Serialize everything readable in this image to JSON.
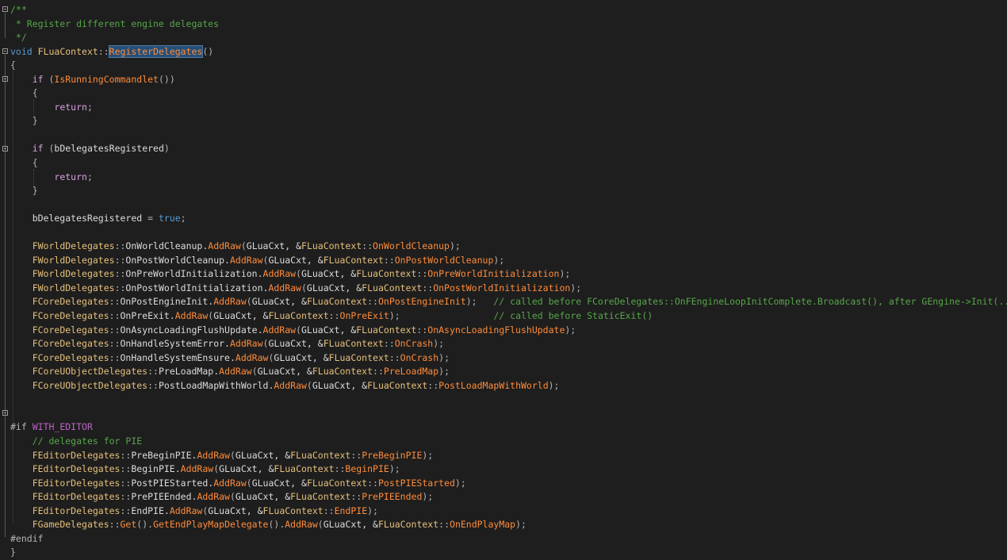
{
  "editor": {
    "lines": [
      [
        [
          "c-comment",
          "/**"
        ]
      ],
      [
        [
          "c-comment",
          " * Register different engine delegates"
        ]
      ],
      [
        [
          "c-comment",
          " */"
        ]
      ],
      [
        [
          "c-kw",
          "void"
        ],
        [
          "c-plain",
          " "
        ],
        [
          "c-type",
          "FLuaContext"
        ],
        [
          "c-punc",
          "::"
        ],
        [
          "sel c-method",
          "RegisterDelegates"
        ],
        [
          "c-punc",
          "()"
        ]
      ],
      [
        [
          "c-punc",
          "{"
        ]
      ],
      [
        [
          "c-plain",
          "    "
        ],
        [
          "c-kw2",
          "if"
        ],
        [
          "c-punc",
          " ("
        ],
        [
          "c-method",
          "IsRunningCommandlet"
        ],
        [
          "c-punc",
          "())"
        ]
      ],
      [
        [
          "c-plain",
          "    "
        ],
        [
          "c-punc",
          "{"
        ]
      ],
      [
        [
          "c-plain",
          "        "
        ],
        [
          "c-kw2",
          "return"
        ],
        [
          "c-punc",
          ";"
        ]
      ],
      [
        [
          "c-plain",
          "    "
        ],
        [
          "c-punc",
          "}"
        ]
      ],
      [
        [
          "c-plain",
          ""
        ]
      ],
      [
        [
          "c-plain",
          "    "
        ],
        [
          "c-kw2",
          "if"
        ],
        [
          "c-punc",
          " ("
        ],
        [
          "c-plain",
          "bDelegatesRegistered"
        ],
        [
          "c-punc",
          ")"
        ]
      ],
      [
        [
          "c-plain",
          "    "
        ],
        [
          "c-punc",
          "{"
        ]
      ],
      [
        [
          "c-plain",
          "        "
        ],
        [
          "c-kw2",
          "return"
        ],
        [
          "c-punc",
          ";"
        ]
      ],
      [
        [
          "c-plain",
          "    "
        ],
        [
          "c-punc",
          "}"
        ]
      ],
      [
        [
          "c-plain",
          ""
        ]
      ],
      [
        [
          "c-plain",
          "    bDelegatesRegistered "
        ],
        [
          "c-punc",
          "= "
        ],
        [
          "c-kw",
          "true"
        ],
        [
          "c-punc",
          ";"
        ]
      ],
      [
        [
          "c-plain",
          ""
        ]
      ],
      [
        [
          "c-plain",
          "    "
        ],
        [
          "c-type",
          "FWorldDelegates"
        ],
        [
          "c-punc",
          "::"
        ],
        [
          "c-plain",
          "OnWorldCleanup."
        ],
        [
          "c-method",
          "AddRaw"
        ],
        [
          "c-punc",
          "("
        ],
        [
          "c-plain",
          "GLuaCxt, &"
        ],
        [
          "c-type",
          "FLuaContext"
        ],
        [
          "c-punc",
          "::"
        ],
        [
          "c-method",
          "OnWorldCleanup"
        ],
        [
          "c-punc",
          ");"
        ]
      ],
      [
        [
          "c-plain",
          "    "
        ],
        [
          "c-type",
          "FWorldDelegates"
        ],
        [
          "c-punc",
          "::"
        ],
        [
          "c-plain",
          "OnPostWorldCleanup."
        ],
        [
          "c-method",
          "AddRaw"
        ],
        [
          "c-punc",
          "("
        ],
        [
          "c-plain",
          "GLuaCxt, &"
        ],
        [
          "c-type",
          "FLuaContext"
        ],
        [
          "c-punc",
          "::"
        ],
        [
          "c-method",
          "OnPostWorldCleanup"
        ],
        [
          "c-punc",
          ");"
        ]
      ],
      [
        [
          "c-plain",
          "    "
        ],
        [
          "c-type",
          "FWorldDelegates"
        ],
        [
          "c-punc",
          "::"
        ],
        [
          "c-plain",
          "OnPreWorldInitialization."
        ],
        [
          "c-method",
          "AddRaw"
        ],
        [
          "c-punc",
          "("
        ],
        [
          "c-plain",
          "GLuaCxt, &"
        ],
        [
          "c-type",
          "FLuaContext"
        ],
        [
          "c-punc",
          "::"
        ],
        [
          "c-method",
          "OnPreWorldInitialization"
        ],
        [
          "c-punc",
          ");"
        ]
      ],
      [
        [
          "c-plain",
          "    "
        ],
        [
          "c-type",
          "FWorldDelegates"
        ],
        [
          "c-punc",
          "::"
        ],
        [
          "c-plain",
          "OnPostWorldInitialization."
        ],
        [
          "c-method",
          "AddRaw"
        ],
        [
          "c-punc",
          "("
        ],
        [
          "c-plain",
          "GLuaCxt, &"
        ],
        [
          "c-type",
          "FLuaContext"
        ],
        [
          "c-punc",
          "::"
        ],
        [
          "c-method",
          "OnPostWorldInitialization"
        ],
        [
          "c-punc",
          ");"
        ]
      ],
      [
        [
          "c-plain",
          "    "
        ],
        [
          "c-type",
          "FCoreDelegates"
        ],
        [
          "c-punc",
          "::"
        ],
        [
          "c-plain",
          "OnPostEngineInit."
        ],
        [
          "c-method",
          "AddRaw"
        ],
        [
          "c-punc",
          "("
        ],
        [
          "c-plain",
          "GLuaCxt, &"
        ],
        [
          "c-type",
          "FLuaContext"
        ],
        [
          "c-punc",
          "::"
        ],
        [
          "c-method",
          "OnPostEngineInit"
        ],
        [
          "c-punc",
          ");   "
        ],
        [
          "c-comment",
          "// called before FCoreDelegates::OnFEngineLoopInitComplete.Broadcast(), after GEngine->Init(...)"
        ]
      ],
      [
        [
          "c-plain",
          "    "
        ],
        [
          "c-type",
          "FCoreDelegates"
        ],
        [
          "c-punc",
          "::"
        ],
        [
          "c-plain",
          "OnPreExit."
        ],
        [
          "c-method",
          "AddRaw"
        ],
        [
          "c-punc",
          "("
        ],
        [
          "c-plain",
          "GLuaCxt, &"
        ],
        [
          "c-type",
          "FLuaContext"
        ],
        [
          "c-punc",
          "::"
        ],
        [
          "c-method",
          "OnPreExit"
        ],
        [
          "c-punc",
          ");                 "
        ],
        [
          "c-comment",
          "// called before StaticExit()"
        ]
      ],
      [
        [
          "c-plain",
          "    "
        ],
        [
          "c-type",
          "FCoreDelegates"
        ],
        [
          "c-punc",
          "::"
        ],
        [
          "c-plain",
          "OnAsyncLoadingFlushUpdate."
        ],
        [
          "c-method",
          "AddRaw"
        ],
        [
          "c-punc",
          "("
        ],
        [
          "c-plain",
          "GLuaCxt, &"
        ],
        [
          "c-type",
          "FLuaContext"
        ],
        [
          "c-punc",
          "::"
        ],
        [
          "c-method",
          "OnAsyncLoadingFlushUpdate"
        ],
        [
          "c-punc",
          ");"
        ]
      ],
      [
        [
          "c-plain",
          "    "
        ],
        [
          "c-type",
          "FCoreDelegates"
        ],
        [
          "c-punc",
          "::"
        ],
        [
          "c-plain",
          "OnHandleSystemError."
        ],
        [
          "c-method",
          "AddRaw"
        ],
        [
          "c-punc",
          "("
        ],
        [
          "c-plain",
          "GLuaCxt, &"
        ],
        [
          "c-type",
          "FLuaContext"
        ],
        [
          "c-punc",
          "::"
        ],
        [
          "c-method",
          "OnCrash"
        ],
        [
          "c-punc",
          ");"
        ]
      ],
      [
        [
          "c-plain",
          "    "
        ],
        [
          "c-type",
          "FCoreDelegates"
        ],
        [
          "c-punc",
          "::"
        ],
        [
          "c-plain",
          "OnHandleSystemEnsure."
        ],
        [
          "c-method",
          "AddRaw"
        ],
        [
          "c-punc",
          "("
        ],
        [
          "c-plain",
          "GLuaCxt, &"
        ],
        [
          "c-type",
          "FLuaContext"
        ],
        [
          "c-punc",
          "::"
        ],
        [
          "c-method",
          "OnCrash"
        ],
        [
          "c-punc",
          ");"
        ]
      ],
      [
        [
          "c-plain",
          "    "
        ],
        [
          "c-type",
          "FCoreUObjectDelegates"
        ],
        [
          "c-punc",
          "::"
        ],
        [
          "c-plain",
          "PreLoadMap."
        ],
        [
          "c-method",
          "AddRaw"
        ],
        [
          "c-punc",
          "("
        ],
        [
          "c-plain",
          "GLuaCxt, &"
        ],
        [
          "c-type",
          "FLuaContext"
        ],
        [
          "c-punc",
          "::"
        ],
        [
          "c-method",
          "PreLoadMap"
        ],
        [
          "c-punc",
          ");"
        ]
      ],
      [
        [
          "c-plain",
          "    "
        ],
        [
          "c-type",
          "FCoreUObjectDelegates"
        ],
        [
          "c-punc",
          "::"
        ],
        [
          "c-plain",
          "PostLoadMapWithWorld."
        ],
        [
          "c-method",
          "AddRaw"
        ],
        [
          "c-punc",
          "("
        ],
        [
          "c-plain",
          "GLuaCxt, &"
        ],
        [
          "c-type",
          "FLuaContext"
        ],
        [
          "c-punc",
          "::"
        ],
        [
          "c-method",
          "PostLoadMapWithWorld"
        ],
        [
          "c-punc",
          ");"
        ]
      ],
      [
        [
          "c-plain",
          ""
        ]
      ],
      [
        [
          "c-plain",
          ""
        ]
      ],
      [
        [
          "c-punc",
          "#if "
        ],
        [
          "c-macro",
          "WITH_EDITOR"
        ]
      ],
      [
        [
          "c-plain",
          "    "
        ],
        [
          "c-comment",
          "// delegates for PIE"
        ]
      ],
      [
        [
          "c-plain",
          "    "
        ],
        [
          "c-type",
          "FEditorDelegates"
        ],
        [
          "c-punc",
          "::"
        ],
        [
          "c-plain",
          "PreBeginPIE."
        ],
        [
          "c-method",
          "AddRaw"
        ],
        [
          "c-punc",
          "("
        ],
        [
          "c-plain",
          "GLuaCxt, &"
        ],
        [
          "c-type",
          "FLuaContext"
        ],
        [
          "c-punc",
          "::"
        ],
        [
          "c-method",
          "PreBeginPIE"
        ],
        [
          "c-punc",
          ");"
        ]
      ],
      [
        [
          "c-plain",
          "    "
        ],
        [
          "c-type",
          "FEditorDelegates"
        ],
        [
          "c-punc",
          "::"
        ],
        [
          "c-plain",
          "BeginPIE."
        ],
        [
          "c-method",
          "AddRaw"
        ],
        [
          "c-punc",
          "("
        ],
        [
          "c-plain",
          "GLuaCxt, &"
        ],
        [
          "c-type",
          "FLuaContext"
        ],
        [
          "c-punc",
          "::"
        ],
        [
          "c-method",
          "BeginPIE"
        ],
        [
          "c-punc",
          ");"
        ]
      ],
      [
        [
          "c-plain",
          "    "
        ],
        [
          "c-type",
          "FEditorDelegates"
        ],
        [
          "c-punc",
          "::"
        ],
        [
          "c-plain",
          "PostPIEStarted."
        ],
        [
          "c-method",
          "AddRaw"
        ],
        [
          "c-punc",
          "("
        ],
        [
          "c-plain",
          "GLuaCxt, &"
        ],
        [
          "c-type",
          "FLuaContext"
        ],
        [
          "c-punc",
          "::"
        ],
        [
          "c-method",
          "PostPIEStarted"
        ],
        [
          "c-punc",
          ");"
        ]
      ],
      [
        [
          "c-plain",
          "    "
        ],
        [
          "c-type",
          "FEditorDelegates"
        ],
        [
          "c-punc",
          "::"
        ],
        [
          "c-plain",
          "PrePIEEnded."
        ],
        [
          "c-method",
          "AddRaw"
        ],
        [
          "c-punc",
          "("
        ],
        [
          "c-plain",
          "GLuaCxt, &"
        ],
        [
          "c-type",
          "FLuaContext"
        ],
        [
          "c-punc",
          "::"
        ],
        [
          "c-method",
          "PrePIEEnded"
        ],
        [
          "c-punc",
          ");"
        ]
      ],
      [
        [
          "c-plain",
          "    "
        ],
        [
          "c-type",
          "FEditorDelegates"
        ],
        [
          "c-punc",
          "::"
        ],
        [
          "c-plain",
          "EndPIE."
        ],
        [
          "c-method",
          "AddRaw"
        ],
        [
          "c-punc",
          "("
        ],
        [
          "c-plain",
          "GLuaCxt, &"
        ],
        [
          "c-type",
          "FLuaContext"
        ],
        [
          "c-punc",
          "::"
        ],
        [
          "c-method",
          "EndPIE"
        ],
        [
          "c-punc",
          ");"
        ]
      ],
      [
        [
          "c-plain",
          "    "
        ],
        [
          "c-type",
          "FGameDelegates"
        ],
        [
          "c-punc",
          "::"
        ],
        [
          "c-method",
          "Get"
        ],
        [
          "c-punc",
          "()."
        ],
        [
          "c-method",
          "GetEndPlayMapDelegate"
        ],
        [
          "c-punc",
          "()."
        ],
        [
          "c-method",
          "AddRaw"
        ],
        [
          "c-punc",
          "("
        ],
        [
          "c-plain",
          "GLuaCxt, &"
        ],
        [
          "c-type",
          "FLuaContext"
        ],
        [
          "c-punc",
          "::"
        ],
        [
          "c-method",
          "OnEndPlayMap"
        ],
        [
          "c-punc",
          ");"
        ]
      ],
      [
        [
          "c-punc",
          "#endif"
        ]
      ],
      [
        [
          "c-punc",
          "}"
        ]
      ]
    ]
  }
}
